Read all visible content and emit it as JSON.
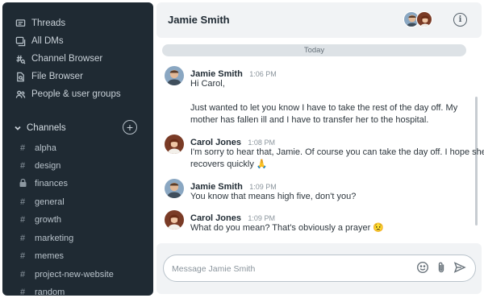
{
  "sidebar": {
    "nav": [
      {
        "label": "Threads",
        "icon": "threads-icon"
      },
      {
        "label": "All DMs",
        "icon": "dms-icon"
      },
      {
        "label": "Channel Browser",
        "icon": "channel-browser-icon"
      },
      {
        "label": "File Browser",
        "icon": "file-browser-icon"
      },
      {
        "label": "People & user groups",
        "icon": "people-icon"
      }
    ],
    "channels_label": "Channels",
    "channels": [
      {
        "name": "alpha",
        "private": false
      },
      {
        "name": "design",
        "private": false
      },
      {
        "name": "finances",
        "private": true
      },
      {
        "name": "general",
        "private": false
      },
      {
        "name": "growth",
        "private": false
      },
      {
        "name": "marketing",
        "private": false
      },
      {
        "name": "memes",
        "private": false
      },
      {
        "name": "project-new-website",
        "private": false
      },
      {
        "name": "random",
        "private": false
      }
    ],
    "hash_glyph": "#"
  },
  "header": {
    "title": "Jamie Smith",
    "info_glyph": "i"
  },
  "day_divider": "Today",
  "messages": [
    {
      "author": "Jamie Smith",
      "time": "1:06 PM",
      "lines": [
        "Hi Carol,",
        "",
        "Just wanted to let you know I have to take the rest of the day off. My",
        "mother has fallen ill and I have to transfer her to the hospital."
      ]
    },
    {
      "author": "Carol Jones",
      "time": "1:08 PM",
      "lines": [
        "I'm sorry to hear that, Jamie. Of course you can take the day off. I hope she",
        "recovers quickly 🙏"
      ]
    },
    {
      "author": "Jamie Smith",
      "time": "1:09 PM",
      "lines": [
        "You know that means high five, don't you?"
      ]
    },
    {
      "author": "Carol Jones",
      "time": "1:09 PM",
      "lines": [
        "What do you mean? That's obviously a prayer 😟"
      ]
    }
  ],
  "composer": {
    "placeholder": "Message Jamie Smith",
    "tools": [
      "emoji-icon",
      "attachment-icon",
      "send-icon"
    ]
  },
  "colors": {
    "sidebar_bg": "#1f2a33",
    "header_bg": "#f1f3f5",
    "divider_bg": "#dde2e6"
  }
}
